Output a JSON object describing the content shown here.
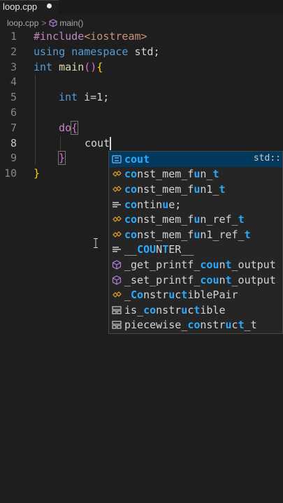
{
  "tab": {
    "filename": "loop.cpp"
  },
  "breadcrumb": {
    "file": "loop.cpp",
    "separator": ">",
    "symbol": "main()"
  },
  "gutter": [
    "1",
    "2",
    "3",
    "4",
    "5",
    "6",
    "7",
    "8",
    "9",
    "10"
  ],
  "code": {
    "l1_include": "#include",
    "l1_header": "<iostream>",
    "l2_using": "using",
    "l2_namespace": "namespace",
    "l2_std": "std;",
    "l3_int": "int",
    "l3_main": "main",
    "l3_paren": "()",
    "l3_brace": "{",
    "l5_int": "int",
    "l5_rest": "i=1;",
    "l7_do": "do",
    "l7_brace": "{",
    "l8_text": "cout",
    "l9_brace": "}",
    "l10_brace": "}"
  },
  "suggestions": [
    {
      "icon": "symbol-variable-icon",
      "pre": "",
      "m": "cout",
      "post": "",
      "detail": "std::",
      "selected": true
    },
    {
      "icon": "class-icon",
      "pre": "",
      "m": "co",
      "post": "nst_mem_f",
      "m2": "u",
      "post2": "n_",
      "m3": "t",
      "post3": ""
    },
    {
      "icon": "class-icon",
      "pre": "",
      "m": "co",
      "post": "nst_mem_f",
      "m2": "u",
      "post2": "n1_",
      "m3": "t",
      "post3": ""
    },
    {
      "icon": "keyword-icon",
      "pre": "",
      "m": "co",
      "post": "ntin",
      "m2": "u",
      "post2": "e;",
      "m3": "",
      "post3": ""
    },
    {
      "icon": "class-icon",
      "pre": "",
      "m": "co",
      "post": "nst_mem_f",
      "m2": "u",
      "post2": "n_ref_",
      "m3": "t",
      "post3": ""
    },
    {
      "icon": "class-icon",
      "pre": "",
      "m": "co",
      "post": "nst_mem_f",
      "m2": "u",
      "post2": "n1_ref_",
      "m3": "t",
      "post3": ""
    },
    {
      "icon": "keyword-icon",
      "pre": "__",
      "m": "CO",
      "post": "",
      "m2": "U",
      "post2": "N",
      "m3": "T",
      "post3": "ER__"
    },
    {
      "icon": "method-icon",
      "pre": "_get_printf_",
      "m": "co",
      "post": "",
      "m2": "u",
      "post2": "n",
      "m3": "t",
      "post3": "_output"
    },
    {
      "icon": "method-icon",
      "pre": "_set_printf_",
      "m": "co",
      "post": "",
      "m2": "u",
      "post2": "n",
      "m3": "t",
      "post3": "_output"
    },
    {
      "icon": "class-icon",
      "pre": "_",
      "m": "Co",
      "post": "nstr",
      "m2": "u",
      "post2": "c",
      "m3": "t",
      "post3": "iblePair"
    },
    {
      "icon": "struct-icon",
      "pre": "is_",
      "m": "co",
      "post": "nstr",
      "m2": "u",
      "post2": "c",
      "m3": "t",
      "post3": "ible"
    },
    {
      "icon": "struct-icon",
      "pre": "piecewise_",
      "m": "co",
      "post": "nstr",
      "m2": "u",
      "post2": "c",
      "m3": "t",
      "post3": "_t"
    }
  ]
}
